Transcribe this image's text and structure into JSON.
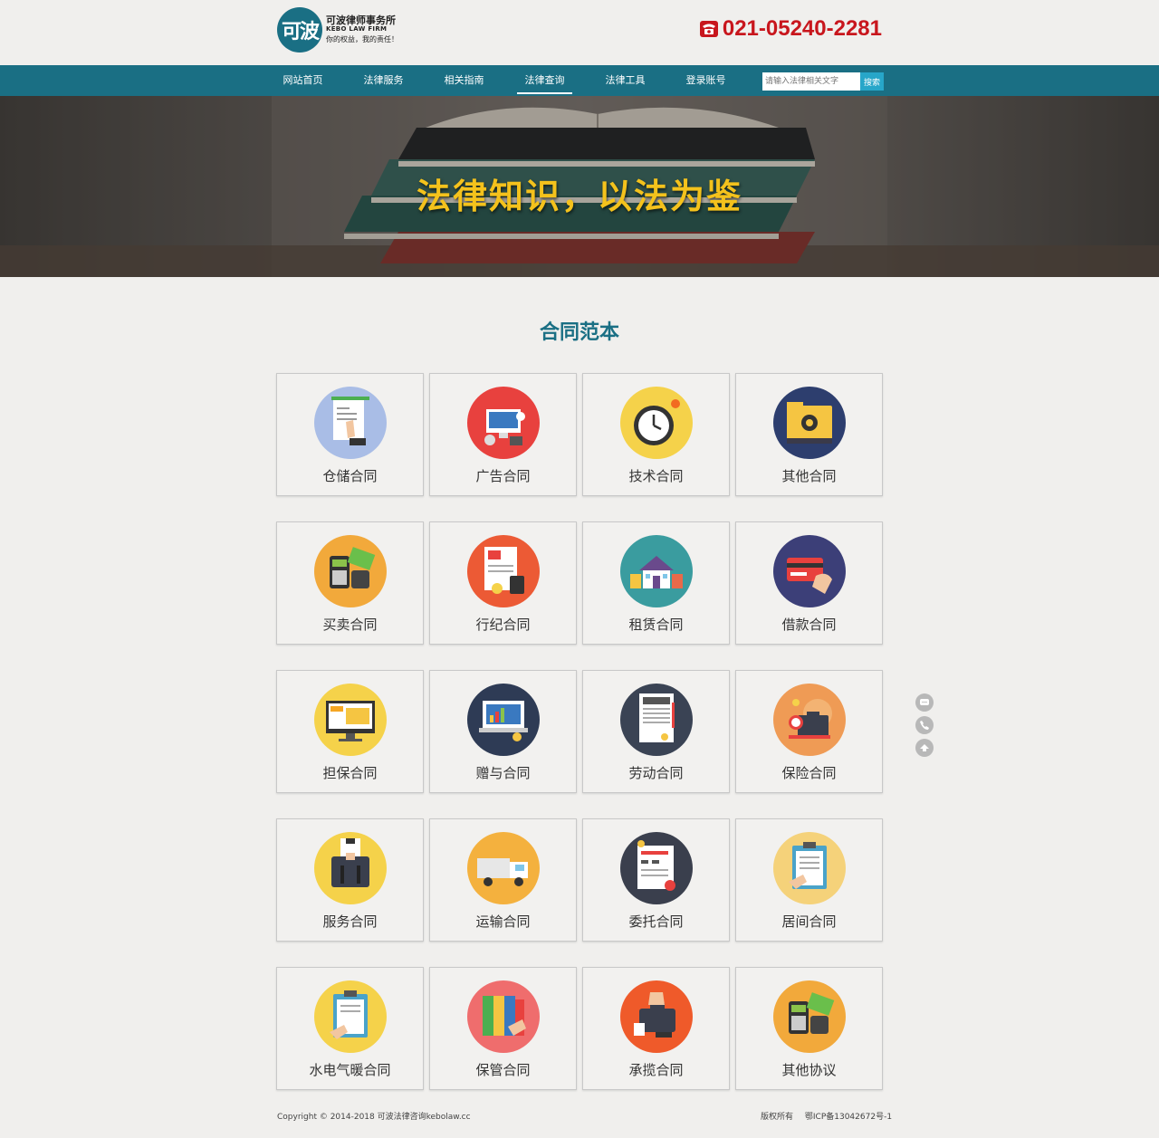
{
  "header": {
    "logo_mark": "可波",
    "firm_name_cn": "可波律师事务所",
    "firm_name_en": "KEBO LAW FIRM",
    "slogan": "你的权益，我的责任！",
    "phone": "021-05240-2281"
  },
  "nav": {
    "items": [
      {
        "label": "网站首页",
        "active": false
      },
      {
        "label": "法律服务",
        "active": false
      },
      {
        "label": "相关指南",
        "active": false
      },
      {
        "label": "法律查询",
        "active": true
      },
      {
        "label": "法律工具",
        "active": false
      },
      {
        "label": "登录账号",
        "active": false
      }
    ],
    "search_placeholder": "请输入法律相关文字",
    "search_button": "搜索"
  },
  "banner": {
    "title": "法律知识，以法为鉴"
  },
  "section": {
    "title": "合同范本",
    "cards": [
      {
        "label": "仓储合同",
        "icon": "warehouse-contract-icon",
        "bg": "#a9bde6"
      },
      {
        "label": "广告合同",
        "icon": "advertising-icon",
        "bg": "#e8413e"
      },
      {
        "label": "技术合同",
        "icon": "clock-gear-icon",
        "bg": "#f5d24a"
      },
      {
        "label": "其他合同",
        "icon": "folder-gear-icon",
        "bg": "#2d3e6e"
      },
      {
        "label": "买卖合同",
        "icon": "money-calculator-icon",
        "bg": "#f2a93b"
      },
      {
        "label": "行纪合同",
        "icon": "report-calculator-icon",
        "bg": "#ec5a35"
      },
      {
        "label": "租赁合同",
        "icon": "house-icon",
        "bg": "#3a9c9f"
      },
      {
        "label": "借款合同",
        "icon": "credit-card-icon",
        "bg": "#3c3f78"
      },
      {
        "label": "担保合同",
        "icon": "monitor-icon",
        "bg": "#f5d24a"
      },
      {
        "label": "赠与合同",
        "icon": "laptop-chart-icon",
        "bg": "#2e3b55"
      },
      {
        "label": "劳动合同",
        "icon": "document-icon",
        "bg": "#3a4354"
      },
      {
        "label": "保险合同",
        "icon": "briefcase-globe-icon",
        "bg": "#ef9b55"
      },
      {
        "label": "服务合同",
        "icon": "suit-briefcase-icon",
        "bg": "#f5d24a"
      },
      {
        "label": "运输合同",
        "icon": "truck-icon",
        "bg": "#f4b13e"
      },
      {
        "label": "委托合同",
        "icon": "form-stamp-icon",
        "bg": "#3a3f4d"
      },
      {
        "label": "居间合同",
        "icon": "clipboard-icon",
        "bg": "#f5d27a"
      },
      {
        "label": "水电气暖合同",
        "icon": "clipboard-hand-icon",
        "bg": "#f5d24a"
      },
      {
        "label": "保管合同",
        "icon": "binders-icon",
        "bg": "#ef6d6d"
      },
      {
        "label": "承揽合同",
        "icon": "briefcase-hand-icon",
        "bg": "#ef5a2a"
      },
      {
        "label": "其他协议",
        "icon": "money-phone-icon",
        "bg": "#f2a93b"
      }
    ]
  },
  "side_tools": [
    {
      "icon": "chat-icon"
    },
    {
      "icon": "phone-icon"
    },
    {
      "icon": "back-to-top-icon"
    }
  ],
  "footer": {
    "copyright": "Copyright © 2014-2018 可波法律咨询kebolaw.cc",
    "rights": "版权所有",
    "icp": "鄂ICP备13042672号-1"
  }
}
